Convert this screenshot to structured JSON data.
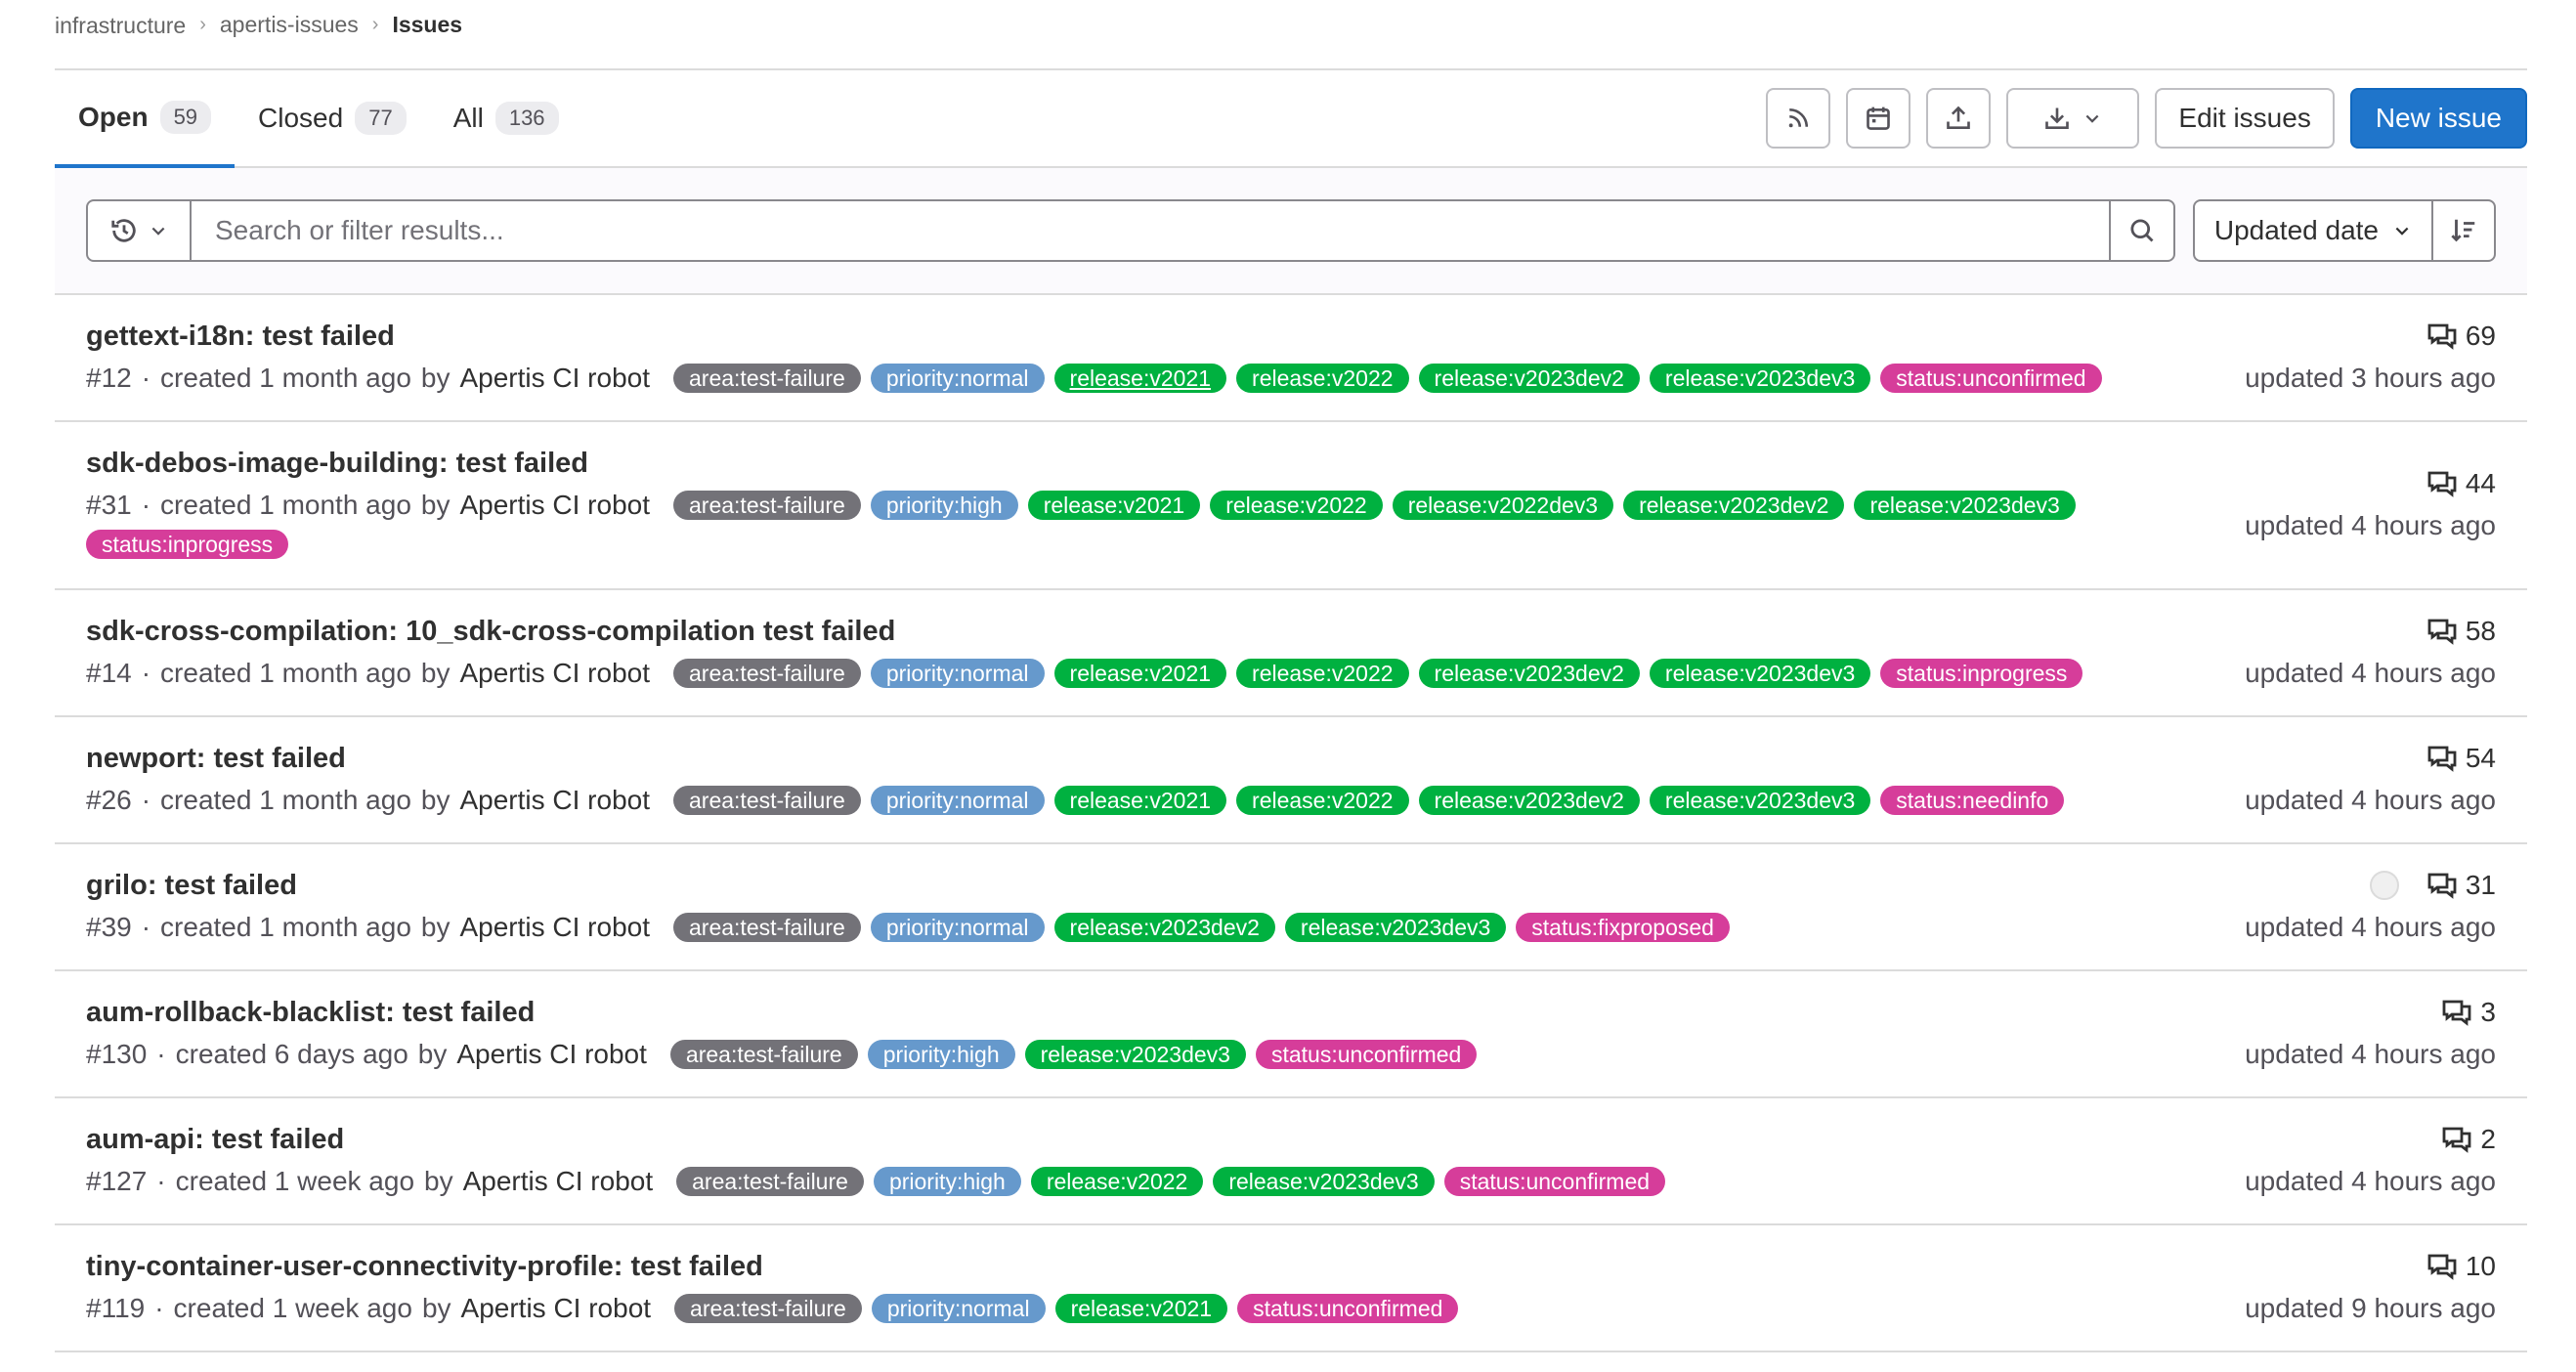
{
  "breadcrumb": [
    "infrastructure",
    "apertis-issues",
    "Issues"
  ],
  "tabs": [
    {
      "label": "Open",
      "count": "59"
    },
    {
      "label": "Closed",
      "count": "77"
    },
    {
      "label": "All",
      "count": "136"
    }
  ],
  "actions": {
    "edit": "Edit issues",
    "new": "New issue"
  },
  "search": {
    "placeholder": "Search or filter results..."
  },
  "sort": {
    "label": "Updated date"
  },
  "colors": {
    "area": "#737278",
    "priority": "#6699cc",
    "release": "#00b140",
    "status": "#d63d9a",
    "primary": "#1f75cb"
  },
  "issues": [
    {
      "title": "gettext-i18n: test failed",
      "ref": "#12",
      "created": "created 1 month ago",
      "by": "by",
      "author": "Apertis CI robot",
      "comments": "69",
      "updated": "updated 3 hours ago",
      "labels": [
        "area:test-failure",
        "priority:normal",
        "release:v2021",
        "release:v2022",
        "release:v2023dev2",
        "release:v2023dev3",
        "status:unconfirmed"
      ]
    },
    {
      "title": "sdk-debos-image-building: test failed",
      "ref": "#31",
      "created": "created 1 month ago",
      "by": "by",
      "author": "Apertis CI robot",
      "comments": "44",
      "updated": "updated 4 hours ago",
      "labels": [
        "area:test-failure",
        "priority:high",
        "release:v2021",
        "release:v2022",
        "release:v2022dev3",
        "release:v2023dev2",
        "release:v2023dev3",
        "status:inprogress"
      ]
    },
    {
      "title": "sdk-cross-compilation: 10_sdk-cross-compilation test failed",
      "ref": "#14",
      "created": "created 1 month ago",
      "by": "by",
      "author": "Apertis CI robot",
      "comments": "58",
      "updated": "updated 4 hours ago",
      "labels": [
        "area:test-failure",
        "priority:normal",
        "release:v2021",
        "release:v2022",
        "release:v2023dev2",
        "release:v2023dev3",
        "status:inprogress"
      ]
    },
    {
      "title": "newport: test failed",
      "ref": "#26",
      "created": "created 1 month ago",
      "by": "by",
      "author": "Apertis CI robot",
      "comments": "54",
      "updated": "updated 4 hours ago",
      "labels": [
        "area:test-failure",
        "priority:normal",
        "release:v2021",
        "release:v2022",
        "release:v2023dev2",
        "release:v2023dev3",
        "status:needinfo"
      ]
    },
    {
      "title": "grilo: test failed",
      "ref": "#39",
      "created": "created 1 month ago",
      "by": "by",
      "author": "Apertis CI robot",
      "comments": "31",
      "updated": "updated 4 hours ago",
      "labels": [
        "area:test-failure",
        "priority:normal",
        "release:v2023dev2",
        "release:v2023dev3",
        "status:fixproposed"
      ]
    },
    {
      "title": "aum-rollback-blacklist: test failed",
      "ref": "#130",
      "created": "created 6 days ago",
      "by": "by",
      "author": "Apertis CI robot",
      "comments": "3",
      "updated": "updated 4 hours ago",
      "labels": [
        "area:test-failure",
        "priority:high",
        "release:v2023dev3",
        "status:unconfirmed"
      ]
    },
    {
      "title": "aum-api: test failed",
      "ref": "#127",
      "created": "created 1 week ago",
      "by": "by",
      "author": "Apertis CI robot",
      "comments": "2",
      "updated": "updated 4 hours ago",
      "labels": [
        "area:test-failure",
        "priority:high",
        "release:v2022",
        "release:v2023dev3",
        "status:unconfirmed"
      ]
    },
    {
      "title": "tiny-container-user-connectivity-profile: test failed",
      "ref": "#119",
      "created": "created 1 week ago",
      "by": "by",
      "author": "Apertis CI robot",
      "comments": "10",
      "updated": "updated 9 hours ago",
      "labels": [
        "area:test-failure",
        "priority:normal",
        "release:v2021",
        "status:unconfirmed"
      ]
    }
  ]
}
